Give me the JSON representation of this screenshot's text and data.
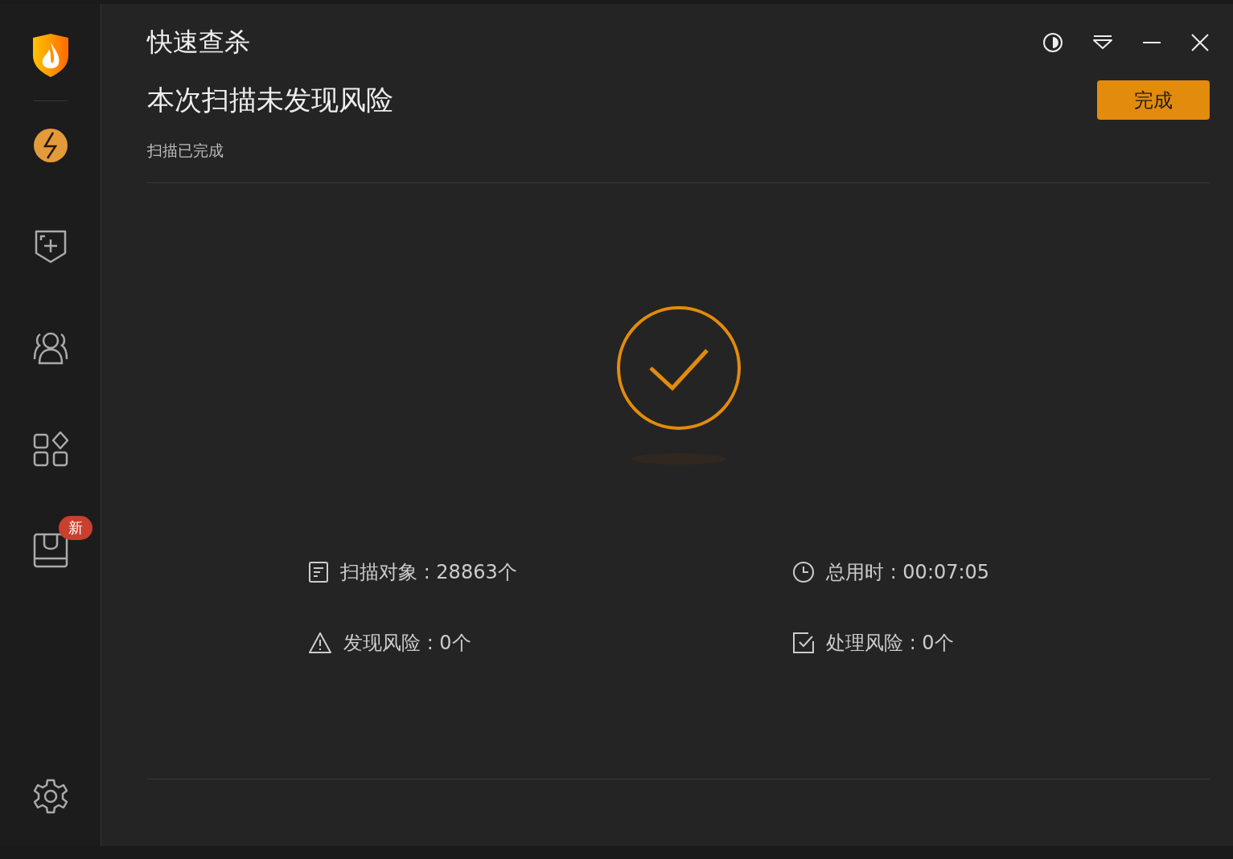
{
  "window": {
    "title": "快速查杀"
  },
  "sidebar": {
    "items": [
      {
        "kind": "bolt",
        "selected": true
      },
      {
        "kind": "shield-plus",
        "selected": false
      },
      {
        "kind": "users",
        "selected": false
      },
      {
        "kind": "apps",
        "selected": false
      },
      {
        "kind": "box",
        "selected": false,
        "badge": "新"
      }
    ]
  },
  "result": {
    "heading": "本次扫描未发现风险",
    "status": "扫描已完成",
    "button": "完成"
  },
  "stats": [
    {
      "kind": "document",
      "label": "扫描对象 : 28863个"
    },
    {
      "kind": "clock",
      "label": "总用时 : 00:07:05"
    },
    {
      "kind": "warning",
      "label": "发现风险 : 0个"
    },
    {
      "kind": "check",
      "label": "处理风险 : 0个"
    }
  ]
}
